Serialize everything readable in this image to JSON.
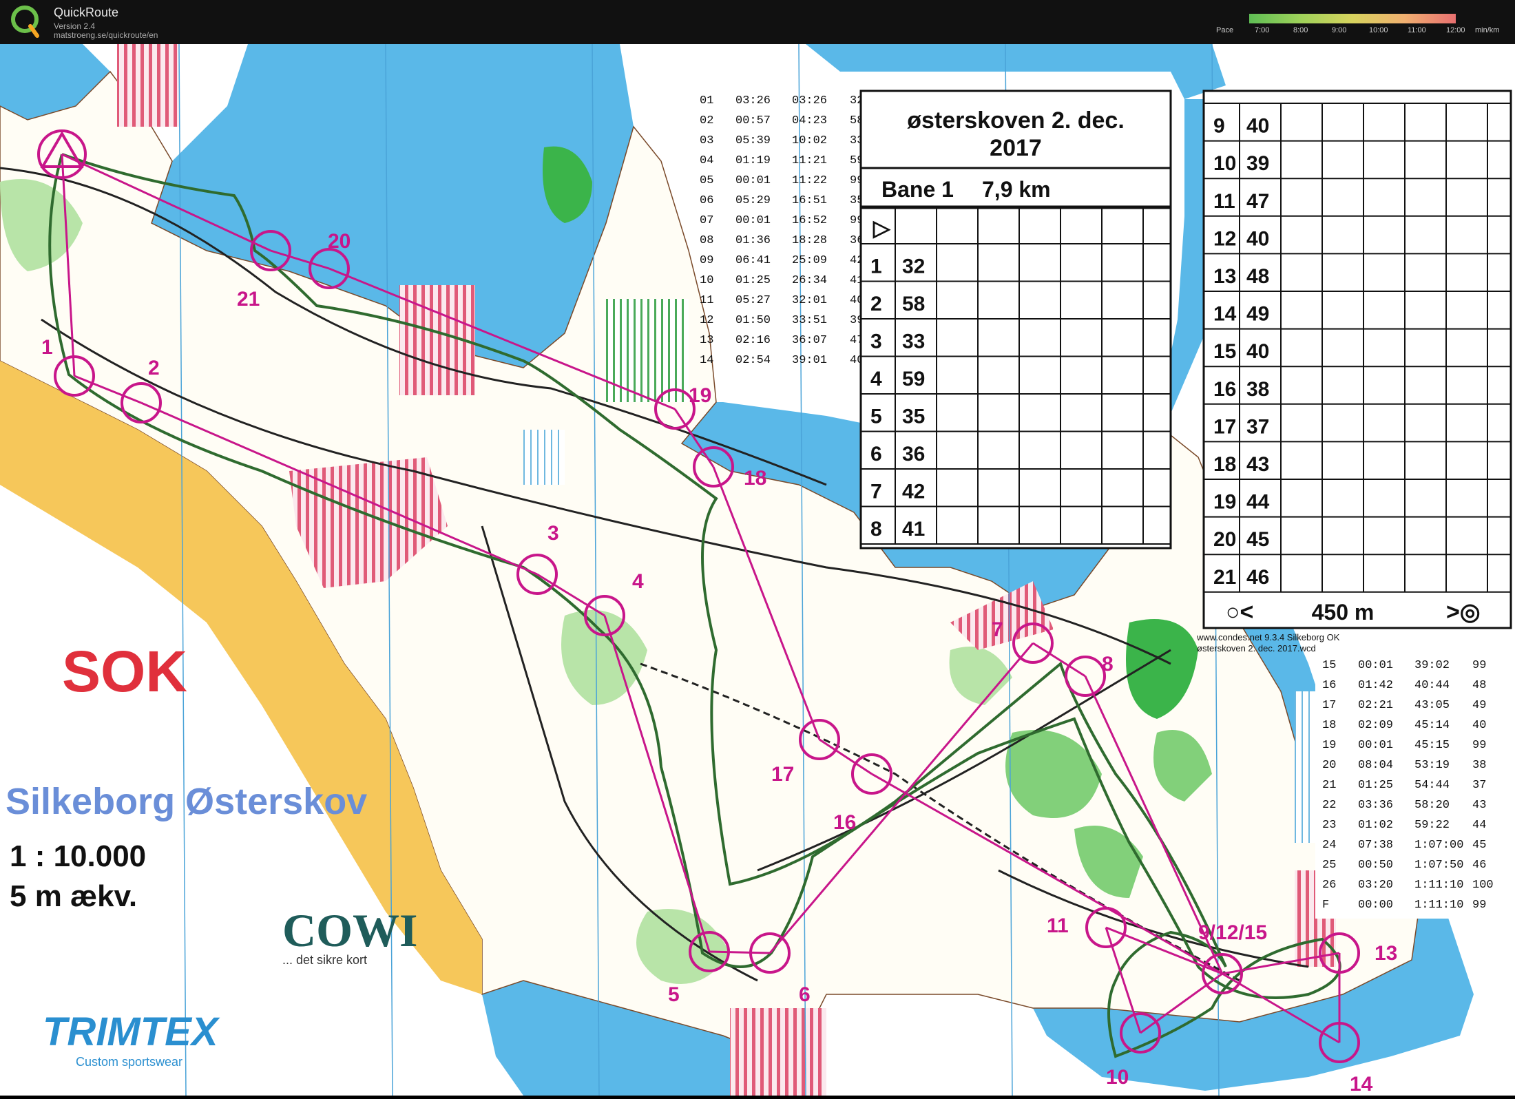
{
  "app": {
    "name": "QuickRoute",
    "version": "Version 2.4",
    "url": "matstroeng.se/quickroute/en"
  },
  "pace_legend": {
    "label": "Pace",
    "ticks": [
      "7:00",
      "8:00",
      "9:00",
      "10:00",
      "11:00",
      "12:00"
    ],
    "unit": "min/km"
  },
  "map": {
    "title": "Silkeborg Østerskov",
    "scale": "1 : 10.000",
    "contour": "5 m ækv.",
    "club_logo": "SOK",
    "sponsor1": "COWI",
    "sponsor1_tag": "... det sikre kort",
    "sponsor2": "TRIMTEX",
    "sponsor2_tag": "Custom sportswear",
    "course_line_color": "#c8168a",
    "route_color": "#2f6b2f",
    "controls": [
      {
        "label": "1"
      },
      {
        "label": "2"
      },
      {
        "label": "3"
      },
      {
        "label": "4"
      },
      {
        "label": "5"
      },
      {
        "label": "6"
      },
      {
        "label": "7"
      },
      {
        "label": "8"
      },
      {
        "label": "9/12/15"
      },
      {
        "label": "10"
      },
      {
        "label": "11"
      },
      {
        "label": "13"
      },
      {
        "label": "14"
      },
      {
        "label": "16"
      },
      {
        "label": "17"
      },
      {
        "label": "18"
      },
      {
        "label": "19"
      },
      {
        "label": "20"
      },
      {
        "label": "21"
      }
    ]
  },
  "splits_top": [
    [
      "01",
      "03:26",
      "03:26",
      "32"
    ],
    [
      "02",
      "00:57",
      "04:23",
      "58"
    ],
    [
      "03",
      "05:39",
      "10:02",
      "33"
    ],
    [
      "04",
      "01:19",
      "11:21",
      "59"
    ],
    [
      "05",
      "00:01",
      "11:22",
      "99"
    ],
    [
      "06",
      "05:29",
      "16:51",
      "35"
    ],
    [
      "07",
      "00:01",
      "16:52",
      "99"
    ],
    [
      "08",
      "01:36",
      "18:28",
      "36"
    ],
    [
      "09",
      "06:41",
      "25:09",
      "42"
    ],
    [
      "10",
      "01:25",
      "26:34",
      "41"
    ],
    [
      "11",
      "05:27",
      "32:01",
      "40"
    ],
    [
      "12",
      "01:50",
      "33:51",
      "39"
    ],
    [
      "13",
      "02:16",
      "36:07",
      "47"
    ],
    [
      "14",
      "02:54",
      "39:01",
      "40"
    ]
  ],
  "splits_bottom": [
    [
      "15",
      "00:01",
      "39:02",
      "99"
    ],
    [
      "16",
      "01:42",
      "40:44",
      "48"
    ],
    [
      "17",
      "02:21",
      "43:05",
      "49"
    ],
    [
      "18",
      "02:09",
      "45:14",
      "40"
    ],
    [
      "19",
      "00:01",
      "45:15",
      "99"
    ],
    [
      "20",
      "08:04",
      "53:19",
      "38"
    ],
    [
      "21",
      "01:25",
      "54:44",
      "37"
    ],
    [
      "22",
      "03:36",
      "58:20",
      "43"
    ],
    [
      "23",
      "01:02",
      "59:22",
      "44"
    ],
    [
      "24",
      "07:38",
      "1:07:00",
      "45"
    ],
    [
      "25",
      "00:50",
      "1:07:50",
      "46"
    ],
    [
      "26",
      "03:20",
      "1:11:10",
      "100"
    ],
    [
      "F",
      "00:00",
      "1:11:10",
      "99"
    ]
  ],
  "description": {
    "title_line1": "østerskoven 2. dec.",
    "title_line2": "2017",
    "course": "Bane 1",
    "length": "7,9 km",
    "rows_left": [
      [
        "1",
        "32"
      ],
      [
        "2",
        "58"
      ],
      [
        "3",
        "33"
      ],
      [
        "4",
        "59"
      ],
      [
        "5",
        "35"
      ],
      [
        "6",
        "36"
      ],
      [
        "7",
        "42"
      ],
      [
        "8",
        "41"
      ]
    ],
    "rows_right": [
      [
        "9",
        "40"
      ],
      [
        "10",
        "39"
      ],
      [
        "11",
        "47"
      ],
      [
        "12",
        "40"
      ],
      [
        "13",
        "48"
      ],
      [
        "14",
        "49"
      ],
      [
        "15",
        "40"
      ],
      [
        "16",
        "38"
      ],
      [
        "17",
        "37"
      ],
      [
        "18",
        "43"
      ],
      [
        "19",
        "44"
      ],
      [
        "20",
        "45"
      ],
      [
        "21",
        "46"
      ]
    ],
    "finish_distance": "450 m",
    "footer_line1": "www.condes.net 9.3.4 Silkeborg OK",
    "footer_line2": "østerskoven 2. dec. 2017.wcd"
  }
}
